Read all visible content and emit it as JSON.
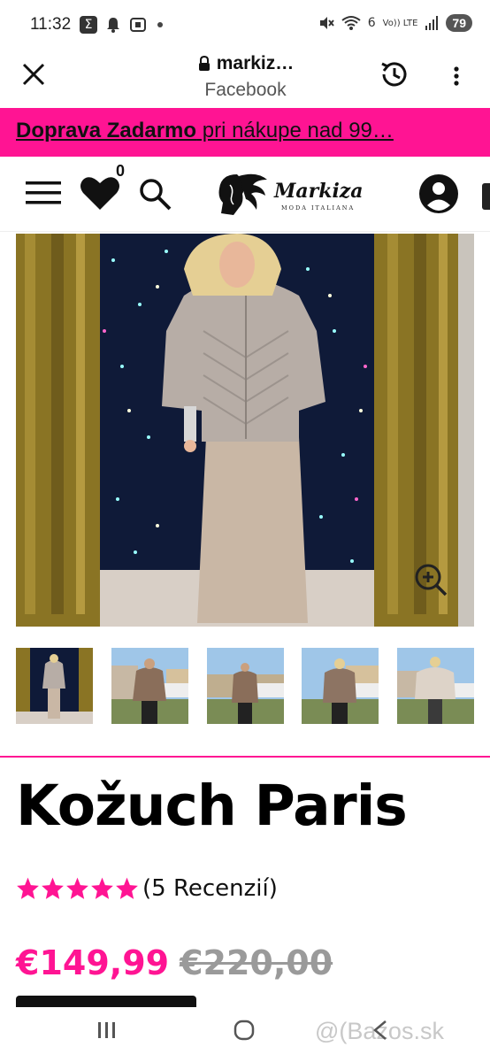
{
  "status_bar": {
    "time": "11:32",
    "sigma_icon": "Σ",
    "network": "Vo)) LTE",
    "signal_number": "6",
    "battery": "79"
  },
  "browser": {
    "url": "markiz…",
    "subtitle": "Facebook"
  },
  "promo": {
    "bold_text": "Doprava Zadarmo",
    "rest_text": " pri nákupe nad 99…"
  },
  "header": {
    "wishlist_count": "0",
    "logo_name": "Markiza",
    "logo_tagline": "MODA ITALIANA"
  },
  "product": {
    "title": "Kožuch Paris",
    "rating": 5,
    "reviews_label": "(5 Recenzií)",
    "price_current": "€149,99",
    "price_old": "€220,00",
    "thumbnail_count": 5
  },
  "colors": {
    "accent": "#ff1493",
    "old_price": "#9a9a9a"
  },
  "watermark": "@(Bazos.sk"
}
